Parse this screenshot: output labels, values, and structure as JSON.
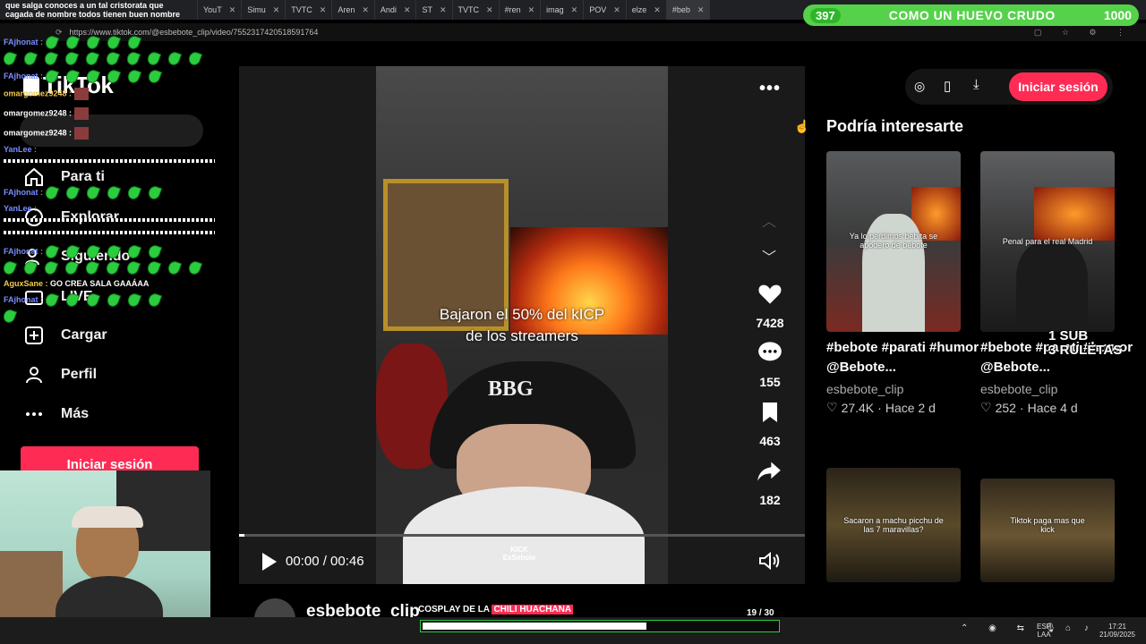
{
  "browser": {
    "tabs": [
      "YouT",
      "Simu",
      "TVTC",
      "Aren",
      "Andi",
      "ST",
      "TVTC",
      "#ren",
      "imag",
      "POV",
      "elze",
      "#beb"
    ],
    "url": "https://www.tiktok.com/@esbebote_clip/video/7552317420518591764"
  },
  "overlay": {
    "top_text": "que salga conoces a un tal cristorata que cagada de nombre todos tienen buen nombre",
    "progress": {
      "left": "397",
      "label": "COMO UN HUEVO CRUDO",
      "right": "1000"
    },
    "chat": [
      {
        "name": "FAjhonat :"
      },
      {
        "name": "FAjhonat :"
      },
      {
        "name": "omargomez9248 :"
      },
      {
        "name": "omargomez9248 :"
      },
      {
        "name": "omargomez9248 :"
      },
      {
        "name": "YanLee :"
      },
      {
        "name": "FAjhonat :"
      },
      {
        "name": "YanLee :"
      },
      {
        "name": "FAjhonat :"
      },
      {
        "name": "AguxSane :",
        "msg": "GO CREA SALA GAAÁAA"
      },
      {
        "name": "FAjhonat :"
      }
    ],
    "sub_text_1": "1 SUB",
    "sub_text_2": "3 RULETAS",
    "bottom_banner_a": "COSPLAY DE LA ",
    "bottom_banner_b": "CHILI HUACHANA",
    "counter": "19 / 30"
  },
  "sidebar": {
    "logo": "TikTok",
    "nav": [
      {
        "label": "Para ti",
        "icon": "home-icon"
      },
      {
        "label": "Explorar",
        "icon": "compass-icon"
      },
      {
        "label": "Siguiendo",
        "icon": "following-icon"
      },
      {
        "label": "LIVE",
        "icon": "live-icon"
      },
      {
        "label": "Cargar",
        "icon": "plus-box-icon"
      },
      {
        "label": "Perfil",
        "icon": "user-icon"
      },
      {
        "label": "Más",
        "icon": "more-icon"
      }
    ],
    "login_label": "Iniciar sesión"
  },
  "video": {
    "caption_line1": "Bajaron el 50% del kICP",
    "caption_line2": "de los streamers",
    "cap_text": "BBG",
    "watermark": "KICK\nEsSebote",
    "likes": "7428",
    "comments": "155",
    "saves": "463",
    "shares": "182",
    "time": "00:00 / 00:46",
    "progress_fraction": 0.01,
    "author": "esbebote_clip"
  },
  "right": {
    "login_label": "Iniciar sesión",
    "title": "Podría interesarte",
    "recs": [
      {
        "thumb_text": "Ya lo perdimos bebita se apodero de bebote",
        "desc": "#bebote #parati #humor @Bebote...",
        "author": "esbebote_clip",
        "likes": "27.4K",
        "when": "Hace 2 d"
      },
      {
        "thumb_text": "Penal para el real Madrid",
        "desc": "#bebote #parati #humor @Bebote...",
        "author": "esbebote_clip",
        "likes": "252",
        "when": "Hace 4 d"
      },
      {
        "thumb_text": "Sacaron a machu picchu de las 7 maravillas?"
      },
      {
        "thumb_text": "Tiktok paga mas que kick"
      }
    ]
  },
  "taskbar": {
    "lang": "ESP",
    "lang2": "LAA",
    "time": "17:21",
    "date": "21/09/2025"
  },
  "colors": {
    "accent": "#fe2c55",
    "overlay_green": "#55d24a"
  }
}
